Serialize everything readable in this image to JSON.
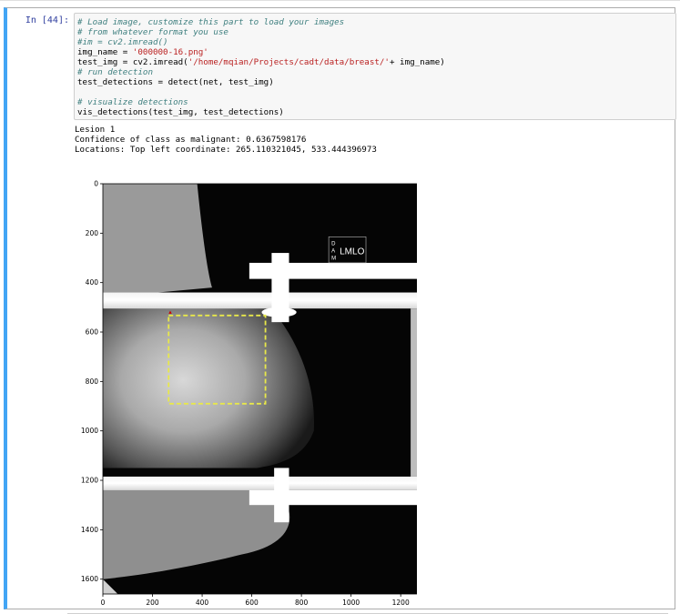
{
  "cell": {
    "prompt": "In [44]:",
    "code_lines": [
      [
        {
          "t": "# Load image, customize this part to load your images",
          "c": "cm"
        }
      ],
      [
        {
          "t": "# from whatever format you use",
          "c": "cm"
        }
      ],
      [
        {
          "t": "#im = cv2.imread()",
          "c": "cm"
        }
      ],
      [
        {
          "t": "img_name = "
        },
        {
          "t": "'000000-16.png'",
          "c": "st"
        }
      ],
      [
        {
          "t": "test_img = cv2.imread("
        },
        {
          "t": "'/home/mqian/Projects/cadt/data/breast/'",
          "c": "st"
        },
        {
          "t": "+ img_name)"
        }
      ],
      [
        {
          "t": "# run detection",
          "c": "cm"
        }
      ],
      [
        {
          "t": "test_detections = detect(net, test_img)"
        }
      ],
      [
        {
          "t": ""
        }
      ],
      [
        {
          "t": "# visualize detections",
          "c": "cm"
        }
      ],
      [
        {
          "t": "vis_detections(test_img, test_detections)"
        }
      ]
    ],
    "output_lines": [
      "Lesion 1",
      "Confidence of class as malignant: 0.6367598176",
      "Locations: Top left coordinate: 265.110321045, 533.444396973"
    ]
  },
  "plot": {
    "x_ticks": [
      0,
      200,
      400,
      600,
      800,
      1000,
      1200
    ],
    "y_ticks": [
      0,
      200,
      400,
      600,
      800,
      1000,
      1200,
      1400,
      1600
    ],
    "x_range": [
      0,
      1280
    ],
    "y_range": [
      0,
      1660
    ],
    "view_label": "LMLO",
    "marker_letters": [
      "D",
      "A",
      "M"
    ],
    "detection_box": {
      "x": 265,
      "y": 533,
      "x2": 655,
      "y2": 890,
      "color": "#e8e84a"
    },
    "detection_marker_color": "#cc0000"
  }
}
